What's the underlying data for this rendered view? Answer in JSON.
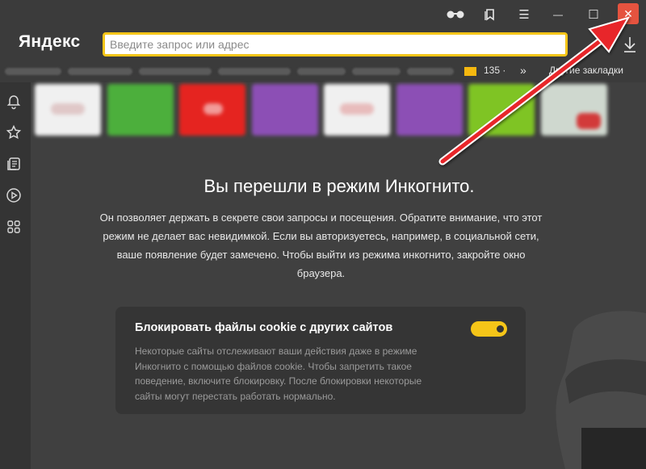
{
  "browser": {
    "logo": "Яндекс",
    "address_placeholder": "Введите запрос или адрес",
    "close_symbol": "✕",
    "minimize_symbol": "—",
    "maximize_symbol": "☐",
    "menu_symbol": "☰"
  },
  "bookmarks": {
    "mail_count": "135 ·",
    "chevron": "»",
    "other_label": "Другие закладки"
  },
  "incognito": {
    "headline": "Вы перешли в режим Инкогнито.",
    "description": "Он позволяет держать в секрете свои запросы и посещения. Обратите внимание, что этот режим не делает вас невидимкой. Если вы авторизуетесь, например, в социальной сети, ваше появление будет замечено. Чтобы выйти из режима инкогнито, закройте окно браузера."
  },
  "cookie_card": {
    "title": "Блокировать файлы cookie с других сайтов",
    "body": "Некоторые сайты отслеживают ваши действия даже в режиме Инкогнито с помощью файлов cookie. Чтобы запретить такое поведение, включите блокировку. После блокировки некоторые сайты могут перестать работать нормально.",
    "toggle_on": true
  },
  "colors": {
    "accent": "#f5c518",
    "close": "#e5533f",
    "arrow": "#e8262a"
  }
}
